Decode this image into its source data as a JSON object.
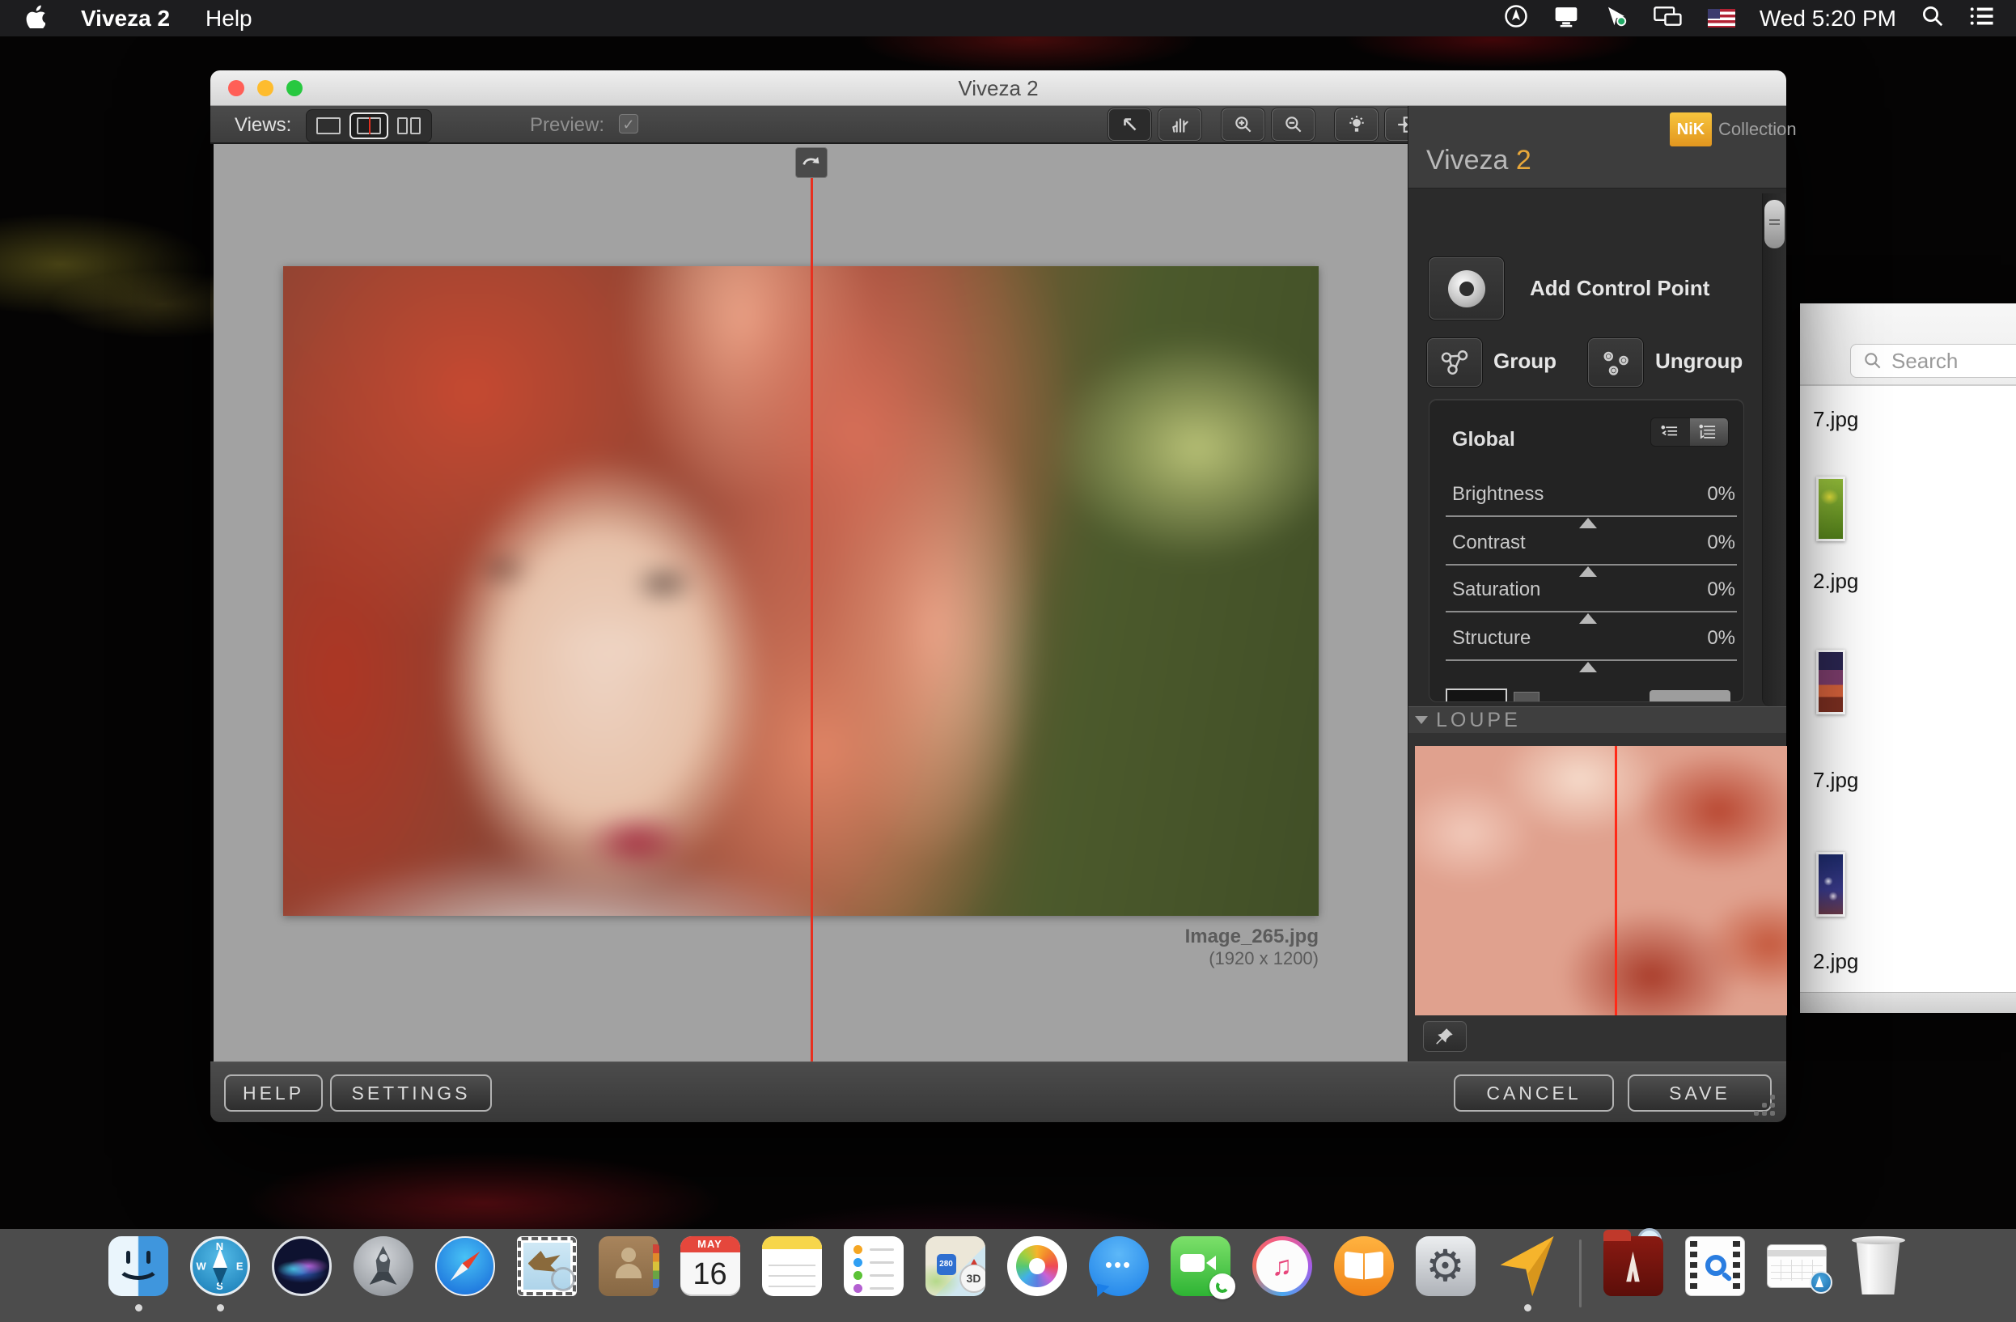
{
  "menu_bar": {
    "app_name": "Viveza 2",
    "menus": [
      "Help"
    ],
    "status_time": "Wed 5:20 PM"
  },
  "window": {
    "title": "Viveza 2",
    "toolbar": {
      "views_label": "Views:",
      "preview_label": "Preview:",
      "preview_check": "✓"
    },
    "canvas": {
      "image_name": "Image_265.jpg",
      "image_dimensions": "(1920 x 1200)"
    },
    "panel": {
      "brand_nik": "NiK",
      "brand_collection": "Collection",
      "title_name": "Viveza",
      "title_version": "2",
      "add_control_point": "Add Control Point",
      "group": "Group",
      "ungroup": "Ungroup",
      "global": {
        "title": "Global",
        "sliders": [
          {
            "label": "Brightness",
            "value": "0%"
          },
          {
            "label": "Contrast",
            "value": "0%"
          },
          {
            "label": "Saturation",
            "value": "0%"
          },
          {
            "label": "Structure",
            "value": "0%"
          }
        ]
      },
      "loupe_title": "LOUPE"
    },
    "footer": {
      "help": "HELP",
      "settings": "SETTINGS",
      "cancel": "CANCEL",
      "save": "SAVE"
    }
  },
  "finder": {
    "search_placeholder": "Search",
    "files": [
      "7.jpg",
      "2.jpg",
      "7.jpg",
      "2.jpg"
    ]
  },
  "dock": {
    "calendar_month": "MAY",
    "calendar_day": "16",
    "maps_route": "280",
    "maps_3d": "3D",
    "compass": {
      "n": "N",
      "s": "S",
      "w": "W",
      "e": "E"
    },
    "messages_dots": "•••"
  },
  "colors": {
    "accent_orange": "#e9a83a",
    "nik_yellow": "#f7c53d",
    "split_line_red": "#e8301f",
    "dock_gray": "#4c4c4c"
  }
}
